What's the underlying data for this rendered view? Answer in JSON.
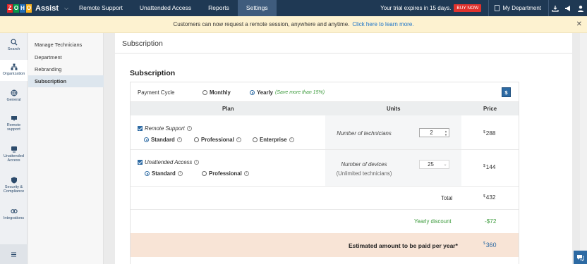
{
  "brand": {
    "logo_letters": [
      "Z",
      "O",
      "H",
      "O"
    ],
    "logo_colors": [
      "#e42527",
      "#089949",
      "#226db4",
      "#f9b21d"
    ],
    "product": "Assist"
  },
  "topnav": {
    "tabs": [
      {
        "label": "Remote Support",
        "active": false
      },
      {
        "label": "Unattended Access",
        "active": false
      },
      {
        "label": "Reports",
        "active": false
      },
      {
        "label": "Settings",
        "active": true
      }
    ],
    "trial_text": "Your trial expires in 15 days.",
    "buy_label": "BUY NOW",
    "department": "My Department",
    "icons": [
      "download-icon",
      "announcement-icon",
      "user-icon"
    ]
  },
  "banner": {
    "text": "Customers can now request a remote session, anywhere and anytime.",
    "link": "Click here to learn more."
  },
  "rail": {
    "items": [
      {
        "label": "Search",
        "icon": "search-icon",
        "active": false
      },
      {
        "label": "Organization",
        "icon": "organization-icon",
        "active": true
      },
      {
        "label": "General",
        "icon": "globe-icon",
        "active": false
      },
      {
        "label": "Remote support",
        "icon": "remote-support-icon",
        "active": false
      },
      {
        "label": "Unattended Access",
        "icon": "unattended-access-icon",
        "active": false
      },
      {
        "label": "Security & Compliance",
        "icon": "shield-icon",
        "active": false
      },
      {
        "label": "Integrations",
        "icon": "integrations-icon",
        "active": false
      }
    ]
  },
  "subnav": {
    "items": [
      {
        "label": "Manage Technicians",
        "active": false
      },
      {
        "label": "Department",
        "active": false
      },
      {
        "label": "Rebranding",
        "active": false
      },
      {
        "label": "Subscription",
        "active": true
      }
    ]
  },
  "main": {
    "page_title": "Subscription",
    "section_title": "Subscription",
    "payment_cycle": {
      "label": "Payment Cycle",
      "monthly": "Monthly",
      "yearly": "Yearly",
      "yearly_note": "(Save more than 15%)",
      "selected": "Yearly",
      "currency_symbol": "$"
    },
    "table": {
      "headers": {
        "plan": "Plan",
        "units": "Units",
        "price": "Price"
      },
      "remote_support": {
        "label": "Remote Support",
        "options": [
          "Standard",
          "Professional",
          "Enterprise"
        ],
        "selected": "Standard",
        "units_label": "Number of technicians",
        "units_value": "2",
        "price_currency": "$",
        "price": "288"
      },
      "unattended_access": {
        "label": "Unattended Access",
        "options": [
          "Standard",
          "Professional"
        ],
        "selected": "Standard",
        "units_label": "Number of devices",
        "units_sub": "(Unlimited technicians)",
        "units_value": "25",
        "price_currency": "$",
        "price": "144"
      },
      "total_label": "Total",
      "total_currency": "$",
      "total": "432",
      "discount_label": "Yearly discount",
      "discount": "-$72",
      "estimate_label": "Estimated amount to be paid per year*",
      "estimate_currency": "$",
      "estimate": "360"
    }
  }
}
